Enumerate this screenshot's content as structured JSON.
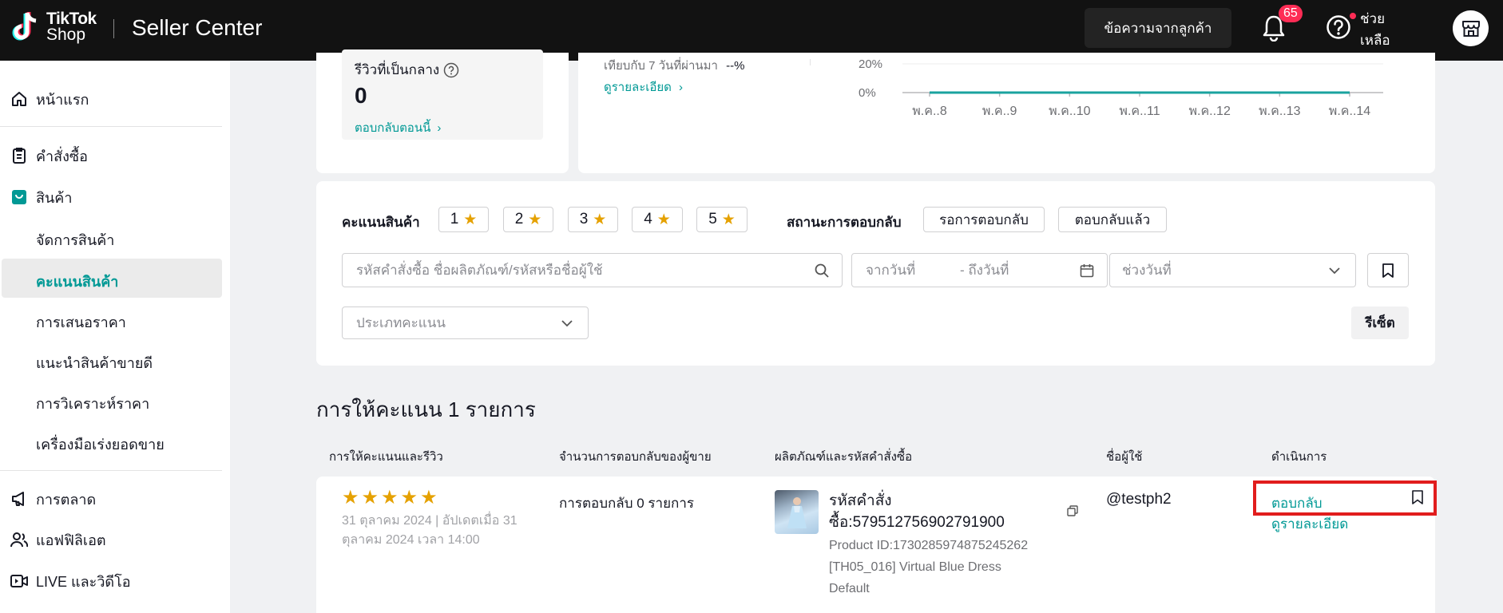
{
  "header": {
    "logo_line1": "TikTok",
    "logo_line2": "Shop",
    "title": "Seller Center",
    "messages_button": "ข้อความจากลูกค้า",
    "notification_count": "65",
    "help_line1": "ช่วย",
    "help_line2": "เหลือ"
  },
  "sidebar": {
    "home": "หน้าแรก",
    "orders": "คำสั่งซื้อ",
    "products": "สินค้า",
    "sub_items": [
      "จัดการสินค้า",
      "คะแนนสินค้า",
      "การเสนอราคา",
      "แนะนำสินค้าขายดี",
      "การวิเคราะห์ราคา",
      "เครื่องมือเร่งยอดขาย"
    ],
    "marketing": "การตลาด",
    "affiliate": "แอฟฟิลิเอต",
    "live_video": "LIVE และวิดีโอ"
  },
  "summary": {
    "neutral_label": "รีวิวที่เป็นกลาง",
    "neutral_value": "0",
    "reply_now": "ตอบกลับตอนนี้",
    "compare_text": "เทียบกับ 7 วันที่ผ่านมา",
    "compare_value": "--%",
    "view_details": "ดูรายละเอียด"
  },
  "chart_data": {
    "type": "line",
    "x": [
      "พ.ค..8",
      "พ.ค..9",
      "พ.ค..10",
      "พ.ค..11",
      "พ.ค..12",
      "พ.ค..13",
      "พ.ค..14"
    ],
    "series": [
      {
        "values": [
          0,
          0,
          0,
          0,
          0,
          0,
          0
        ],
        "color": "#1aa39f"
      }
    ],
    "y_tick_labels": [
      "20%",
      "0%"
    ],
    "ylim": [
      0,
      20
    ]
  },
  "filters": {
    "rating_label": "คะแนนสินค้า",
    "ratings": [
      "1",
      "2",
      "3",
      "4",
      "5"
    ],
    "status_label": "สถานะการตอบกลับ",
    "status_options": [
      "รอการตอบกลับ",
      "ตอบกลับแล้ว"
    ],
    "search_placeholder": "รหัสคำสั่งซื้อ ชื่อผลิตภัณฑ์/รหัสหรือชื่อผู้ใช้",
    "date_from": "จากวันที่",
    "date_to": "- ถึงวันที่",
    "date_range": "ช่วงวันที่",
    "rating_type": "ประเภทคะแนน",
    "reset": "รีเซ็ต"
  },
  "results": {
    "title": "การให้คะแนน 1 รายการ",
    "columns": [
      "การให้คะแนนและรีวิว",
      "จำนวนการตอบกลับของผู้ขาย",
      "ผลิตภัณฑ์และรหัสคำสั่งซื้อ",
      "ชื่อผู้ใช้",
      "ดำเนินการ"
    ],
    "row": {
      "rating": 5,
      "date_line1": "31 ตุลาคม 2024  |  อัปเดตเมื่อ 31",
      "date_line2": "ตุลาคม 2024 เวลา 14:00",
      "reply_count": "การตอบกลับ 0 รายการ",
      "order_label": "รหัสคำสั่ง",
      "order_id": "ซื้อ:579512756902791900",
      "product_id": "Product ID:1730285974875245262",
      "product_name": "[TH05_016] Virtual Blue Dress",
      "variant": "Default",
      "username": "@testph2",
      "action_reply": "ตอบกลับ",
      "action_details": "ดูรายละเอียด"
    }
  },
  "colors": {
    "accent": "#009995",
    "star": "#e5a100",
    "badge": "#fe2c55",
    "highlight": "#e11d1d"
  }
}
